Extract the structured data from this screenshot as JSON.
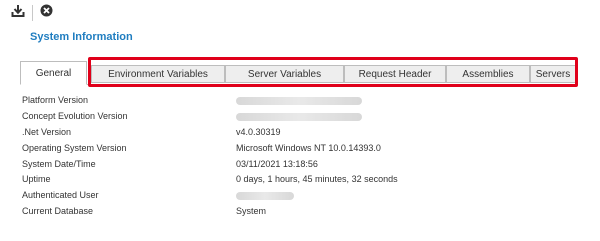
{
  "toolbar": {
    "download_icon": "download-icon",
    "close_icon": "close-circle-icon"
  },
  "title": "System Information",
  "tabs": [
    {
      "label": "General",
      "active": true
    },
    {
      "label": "Environment Variables",
      "active": false
    },
    {
      "label": "Server Variables",
      "active": false
    },
    {
      "label": "Request Header",
      "active": false
    },
    {
      "label": "Assemblies",
      "active": false
    },
    {
      "label": "Servers",
      "active": false
    }
  ],
  "highlight_color": "#e0001a",
  "accent_color": "#1f7dc0",
  "info": [
    {
      "label": "Platform Version",
      "value": "",
      "blurred": true
    },
    {
      "label": "Concept Evolution Version",
      "value": "",
      "blurred": true
    },
    {
      "label": ".Net Version",
      "value": "v4.0.30319",
      "blurred": false
    },
    {
      "label": "Operating System Version",
      "value": "Microsoft Windows NT 10.0.14393.0",
      "blurred": false
    },
    {
      "label": "System Date/Time",
      "value": "03/11/2021 13:18:56",
      "blurred": false
    },
    {
      "label": "Uptime",
      "value": "0 days, 1 hours, 45 minutes, 32 seconds",
      "blurred": false
    },
    {
      "label": "Authenticated User",
      "value": "",
      "blurred": true
    },
    {
      "label": "Current Database",
      "value": "System",
      "blurred": false
    }
  ]
}
